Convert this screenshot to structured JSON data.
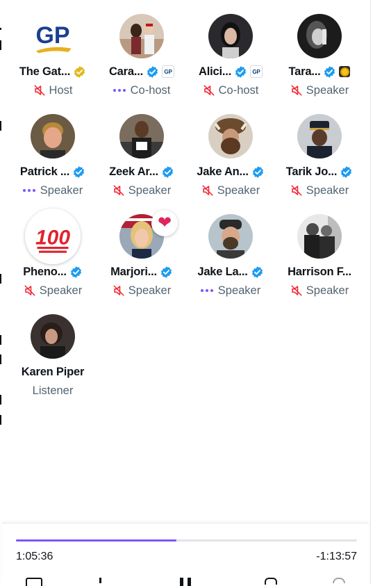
{
  "participants": [
    {
      "name": "The Gat...",
      "role": "Host",
      "role_icon": "mic-off-icon",
      "verified": "gold",
      "affiliate": ""
    },
    {
      "name": "Cara...",
      "role": "Co-host",
      "role_icon": "speaking-dots",
      "verified": "blue",
      "affiliate": "GP"
    },
    {
      "name": "Alici...",
      "role": "Co-host",
      "role_icon": "mic-off-icon",
      "verified": "blue",
      "affiliate": "GP"
    },
    {
      "name": "Tara...",
      "role": "Speaker",
      "role_icon": "mic-off-icon",
      "verified": "blue",
      "affiliate": "sun"
    },
    {
      "name": "Patrick ...",
      "role": "Speaker",
      "role_icon": "speaking-dots",
      "verified": "blue",
      "affiliate": ""
    },
    {
      "name": "Zeek Ar...",
      "role": "Speaker",
      "role_icon": "mic-off-icon",
      "verified": "blue",
      "affiliate": ""
    },
    {
      "name": "Jake An...",
      "role": "Speaker",
      "role_icon": "mic-off-icon",
      "verified": "blue",
      "affiliate": ""
    },
    {
      "name": "Tarik Jo...",
      "role": "Speaker",
      "role_icon": "mic-off-icon",
      "verified": "blue",
      "affiliate": ""
    },
    {
      "name": "Pheno...",
      "role": "Speaker",
      "role_icon": "mic-off-icon",
      "verified": "blue",
      "affiliate": ""
    },
    {
      "name": "Marjori...",
      "role": "Speaker",
      "role_icon": "mic-off-icon",
      "verified": "blue",
      "affiliate": "",
      "reaction": "heart"
    },
    {
      "name": "Jake La...",
      "role": "Speaker",
      "role_icon": "speaking-dots",
      "verified": "blue",
      "affiliate": ""
    },
    {
      "name": "Harrison F...",
      "role": "Speaker",
      "role_icon": "mic-off-icon",
      "verified": "",
      "affiliate": ""
    },
    {
      "name": "Karen Piper",
      "role": "Listener",
      "role_icon": "",
      "verified": "",
      "affiliate": ""
    }
  ],
  "logo_text": "GP",
  "emoji_100": "100",
  "player": {
    "elapsed": "1:05:36",
    "remaining": "-1:13:57",
    "progress_fraction": 0.47
  },
  "colors": {
    "accent": "#7856ff",
    "verified_blue": "#1d9bf0",
    "verified_gold": "#e2b719",
    "mute_red": "#f4212e",
    "muted_text": "#536471"
  }
}
